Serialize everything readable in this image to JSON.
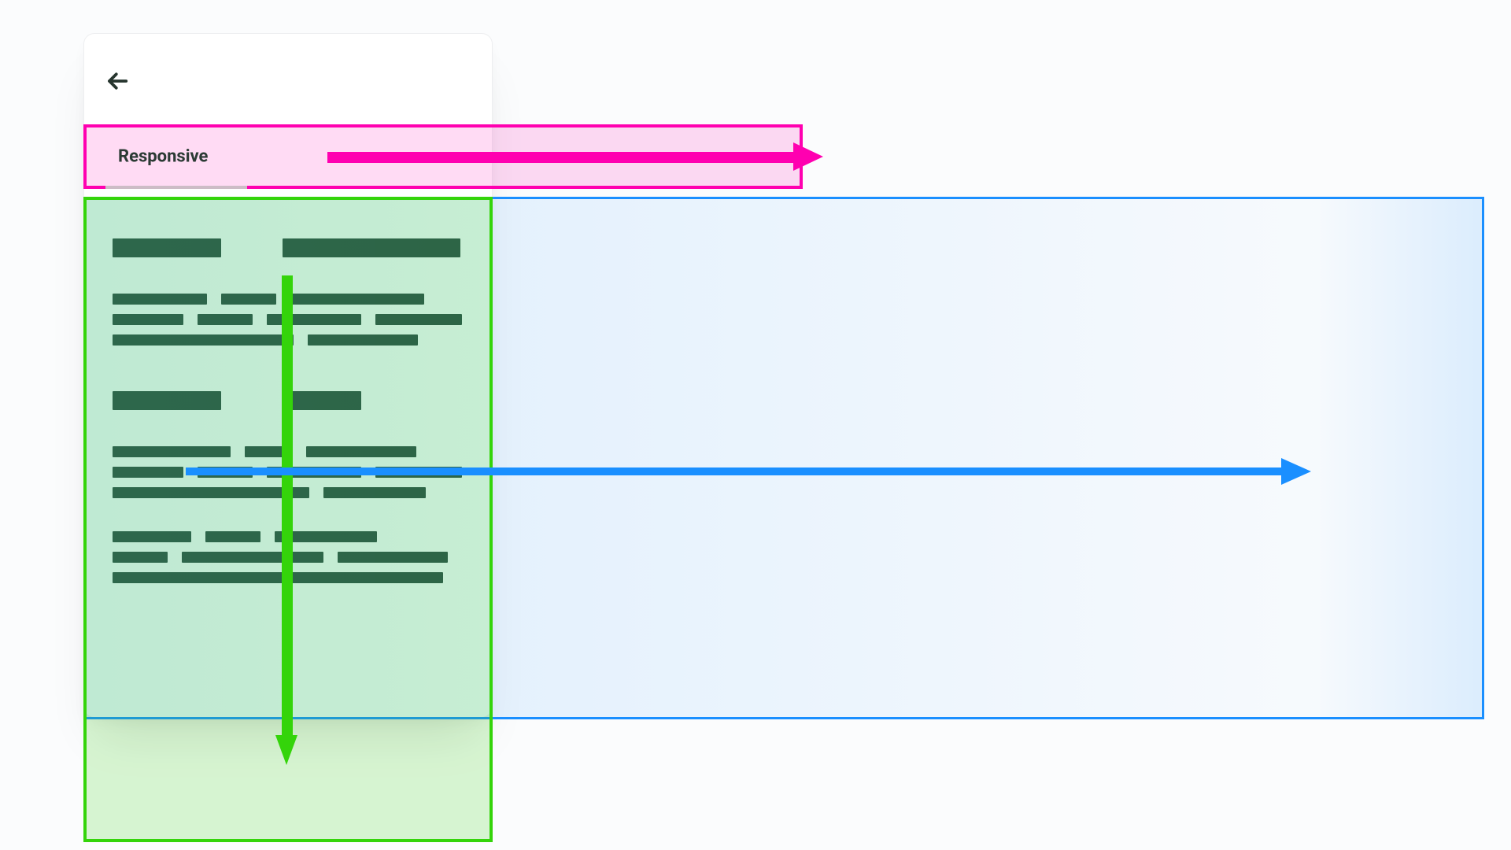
{
  "tabs": {
    "active": "Responsive"
  },
  "colors": {
    "magenta": "#ff00b0",
    "blue": "#1a8fff",
    "green": "#34d40a",
    "bar": "#2f4640"
  },
  "annotations": {
    "magenta_box": "horizontally-scrollable-tabs",
    "blue_box": "expandable-content-width",
    "green_box": "scrollable-content-height",
    "magenta_arrow_dir": "right",
    "blue_arrow_dir": "right",
    "green_arrow_dir": "down"
  }
}
